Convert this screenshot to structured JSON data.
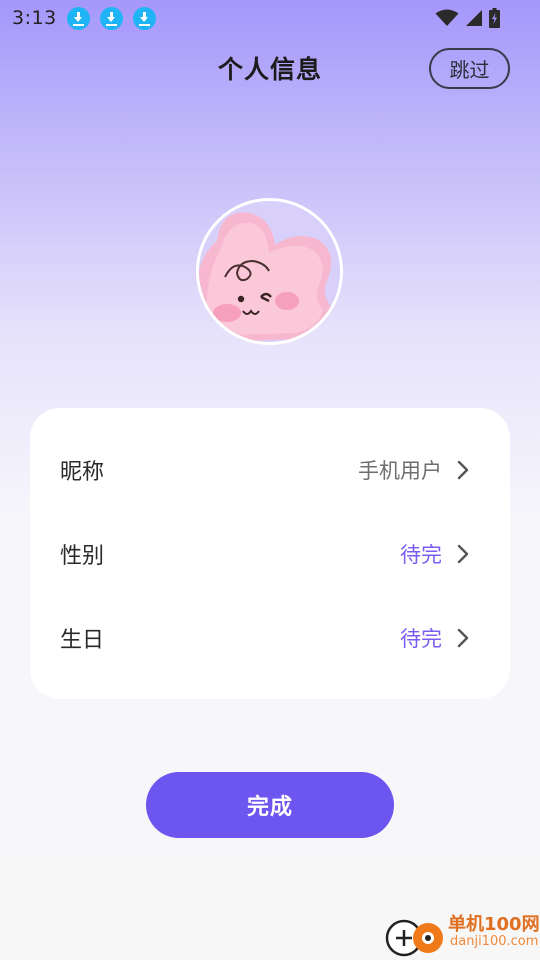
{
  "status_bar": {
    "time": "3:13",
    "notifications": [
      "download-icon",
      "download-icon",
      "download-icon"
    ],
    "icons": [
      "wifi-icon",
      "signal-icon",
      "battery-icon"
    ]
  },
  "header": {
    "title": "个人信息",
    "skip_label": "跳过"
  },
  "profile": {
    "avatar": "pink-cartoon-avatar"
  },
  "form": {
    "rows": [
      {
        "label": "昵称",
        "value": "手机用户",
        "value_color": "#6e6e6e"
      },
      {
        "label": "性别",
        "value": "待完",
        "value_color": "#7a5cf0"
      },
      {
        "label": "生日",
        "value": "待完",
        "value_color": "#7a5cf0"
      }
    ]
  },
  "actions": {
    "done_label": "完成"
  },
  "watermark": {
    "brand": "单机100网",
    "url": "danji100.com"
  },
  "colors": {
    "accent": "#6d55ef",
    "pending_text": "#7a5cf0"
  }
}
